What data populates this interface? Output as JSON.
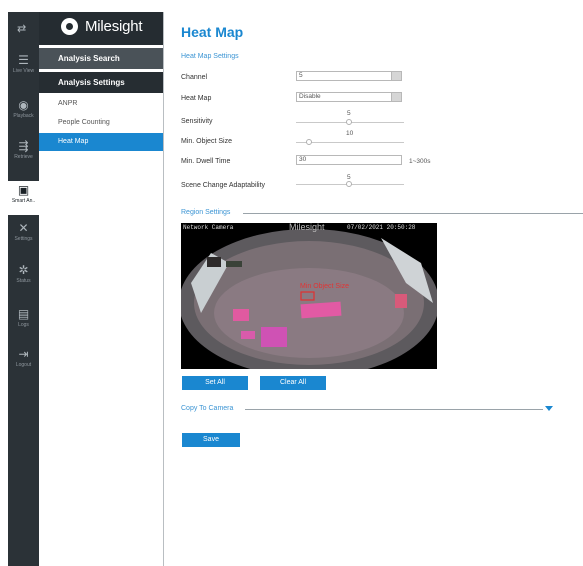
{
  "rail": {
    "items": [
      {
        "label": "Live View",
        "icon": "live-view-icon",
        "glyph": "☰"
      },
      {
        "label": "Playback",
        "icon": "playback-icon",
        "glyph": "◉"
      },
      {
        "label": "Retrieve",
        "icon": "retrieve-icon",
        "glyph": "⇶"
      },
      {
        "label": "Smart An..",
        "icon": "smart-analysis-icon",
        "glyph": "▣"
      },
      {
        "label": "Settings",
        "icon": "settings-icon",
        "glyph": "✕"
      },
      {
        "label": "Status",
        "icon": "status-icon",
        "glyph": "✲"
      },
      {
        "label": "Logs",
        "icon": "logs-icon",
        "glyph": "▤"
      },
      {
        "label": "Logout",
        "icon": "logout-icon",
        "glyph": "⇥"
      }
    ]
  },
  "brand": {
    "name": "Milesight"
  },
  "menu": {
    "analysis_search": "Analysis Search",
    "analysis_settings": "Analysis Settings",
    "items": [
      "ANPR",
      "People Counting",
      "Heat Map"
    ]
  },
  "main": {
    "title": "Heat Map",
    "settings_section": "Heat Map Settings",
    "channel_label": "Channel",
    "channel_value": "5",
    "heatmap_label": "Heat Map",
    "heatmap_value": "Disable",
    "sensitivity_label": "Sensitivity",
    "sensitivity_value": "5",
    "min_object_label": "Min. Object Size",
    "min_object_value": "10",
    "dwell_label": "Min. Dwell Time",
    "dwell_value": "30",
    "dwell_hint": "1~300s",
    "scene_label": "Scene Change Adaptability",
    "scene_value": "5",
    "region_section": "Region Settings",
    "video": {
      "osd_name": "Network Camera",
      "osd_brand": "Milesight",
      "osd_time": "07/02/2021 20:50:28",
      "min_object_text": "Min Object Size"
    },
    "set_all": "Set All",
    "clear_all": "Clear All",
    "copy_to_camera": "Copy To Camera",
    "save": "Save"
  },
  "colors": {
    "accent": "#1a87d0",
    "rail": "#2b3237",
    "menu_head": "#3f474d"
  }
}
